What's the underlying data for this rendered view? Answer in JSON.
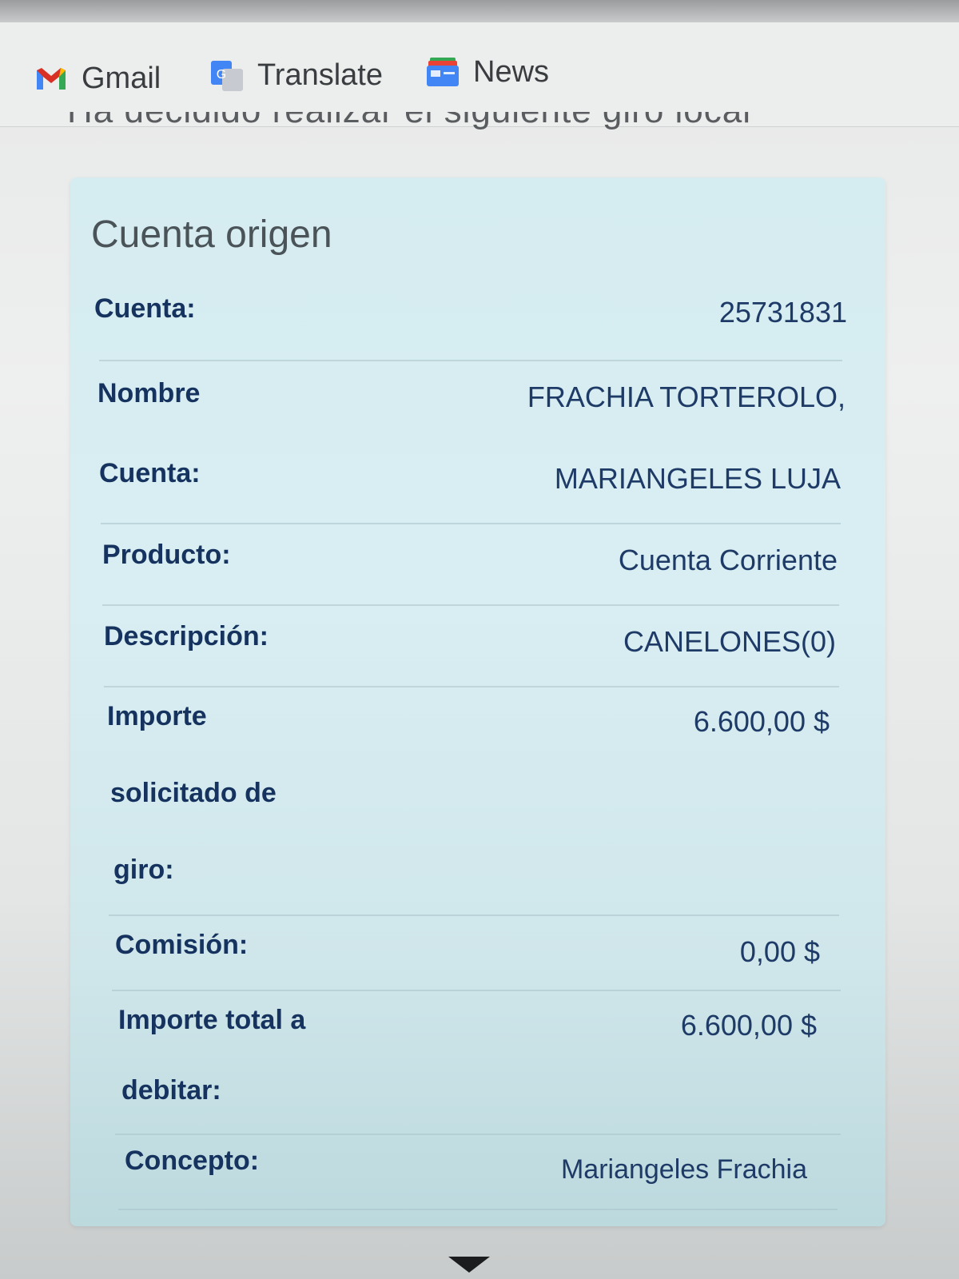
{
  "bookmarks": [
    {
      "label": "Gmail",
      "icon": "gmail-icon"
    },
    {
      "label": "Translate",
      "icon": "translate-icon"
    },
    {
      "label": "News",
      "icon": "news-icon"
    }
  ],
  "partial_heading": "Ha decidido realizar el siguiente giro local",
  "card": {
    "title": "Cuenta origen",
    "rows": [
      {
        "label": "Cuenta:",
        "value": "25731831"
      },
      {
        "label": "Nombre",
        "value": "FRACHIA TORTEROLO,"
      },
      {
        "label": "Cuenta:",
        "value": "MARIANGELES LUJA"
      },
      {
        "label": "Producto:",
        "value": "Cuenta Corriente"
      },
      {
        "label": "Descripción:",
        "value": "CANELONES(0)"
      },
      {
        "label_lines": [
          "Importe",
          "solicitado de",
          "giro:"
        ],
        "value": "6.600,00 $"
      },
      {
        "label": "Comisión:",
        "value": "0,00 $"
      },
      {
        "label_lines": [
          "Importe total a",
          "debitar:"
        ],
        "value": "6.600,00 $"
      },
      {
        "label": "Concepto:",
        "value": "Mariangeles Frachia"
      }
    ]
  },
  "colors": {
    "card_bg": "#d5ecf1",
    "label": "#15335e",
    "value": "#1e3a66",
    "title": "#4a5358"
  }
}
